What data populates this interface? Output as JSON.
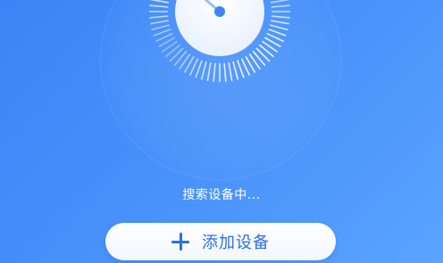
{
  "radar": {
    "icon": "radar-scan-icon",
    "color": "#ffffff"
  },
  "status": {
    "text": "搜索设备中..."
  },
  "add_device": {
    "label": "添加设备",
    "icon": "plus-icon",
    "accent": "#2b6fe5"
  }
}
